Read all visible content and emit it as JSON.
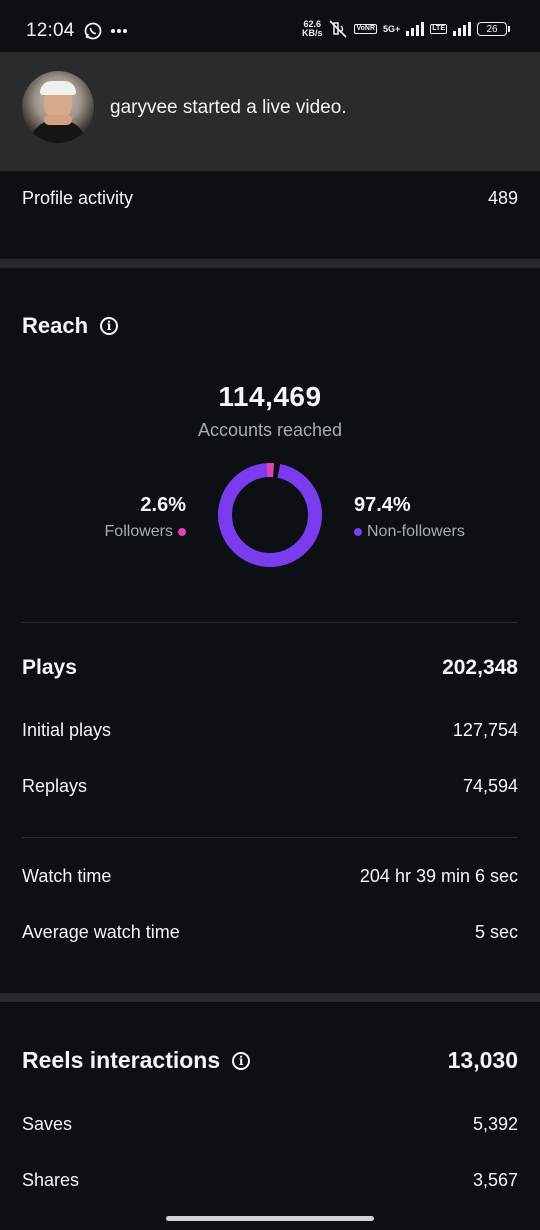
{
  "status_bar": {
    "time": "12:04",
    "net_speed_value": "62.6",
    "net_speed_unit": "KB/s",
    "network_label": "5G+",
    "battery": "26",
    "icons": [
      "whatsapp-icon",
      "more-dots-icon",
      "mute-icon",
      "volte-icon",
      "signal-icon",
      "battery-icon"
    ]
  },
  "notification": {
    "text": "garyvee started a live video."
  },
  "profile_activity": {
    "label": "Profile activity",
    "value": "489"
  },
  "reach": {
    "title": "Reach",
    "accounts_reached": "114,469",
    "accounts_reached_label": "Accounts reached",
    "followers_pct": "2.6%",
    "followers_label": "Followers",
    "non_followers_pct": "97.4%",
    "non_followers_label": "Non-followers",
    "followers_fraction": 0.026,
    "colors": {
      "followers": "#e040b6",
      "non_followers": "#7b3cf0"
    }
  },
  "plays": {
    "label": "Plays",
    "value": "202,348",
    "initial_label": "Initial plays",
    "initial_value": "127,754",
    "replays_label": "Replays",
    "replays_value": "74,594"
  },
  "watch": {
    "watch_time_label": "Watch time",
    "watch_time_value": "204 hr 39 min 6 sec",
    "avg_label": "Average watch time",
    "avg_value": "5 sec"
  },
  "reels_interactions": {
    "title": "Reels interactions",
    "value": "13,030",
    "saves_label": "Saves",
    "saves_value": "5,392",
    "shares_label": "Shares",
    "shares_value": "3,567"
  }
}
